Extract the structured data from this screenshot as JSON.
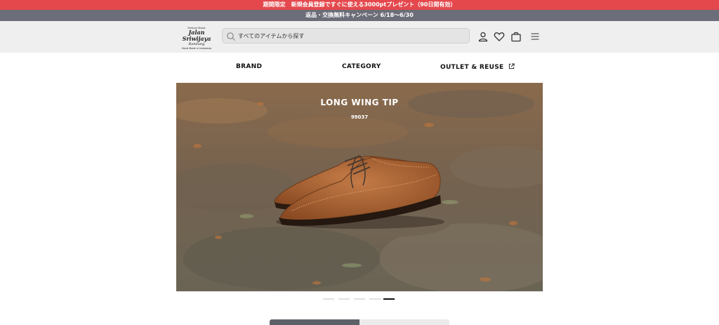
{
  "promo": {
    "top": "期間限定　新規会員登録ですぐに使える3000ptプレゼント（90日間有効）",
    "bottom": "返品・交換無料キャンペーン 6/18〜6/30"
  },
  "header": {
    "logo": {
      "line1": "Fortune Shoes",
      "line2": "Jalan Sriwijaya",
      "line3": "Bandung",
      "line4": "Hand Made in Indonesia"
    },
    "search": {
      "placeholder": "すべてのアイテムから探す"
    },
    "icons": [
      "search-icon",
      "user-icon",
      "heart-icon",
      "bag-icon",
      "menu-icon"
    ]
  },
  "nav": {
    "items": [
      {
        "label": "BRAND"
      },
      {
        "label": "CATEGORY"
      },
      {
        "label": "OUTLET & REUSE",
        "icon": "external-link-icon"
      }
    ]
  },
  "hero": {
    "title": "LONG WING TIP",
    "subtitle": "99037",
    "active_slide": 5,
    "slide_count": 5
  },
  "colors": {
    "promo_red": "#e4484d",
    "promo_gray": "#6b6d78",
    "header_bg": "#efefef"
  }
}
